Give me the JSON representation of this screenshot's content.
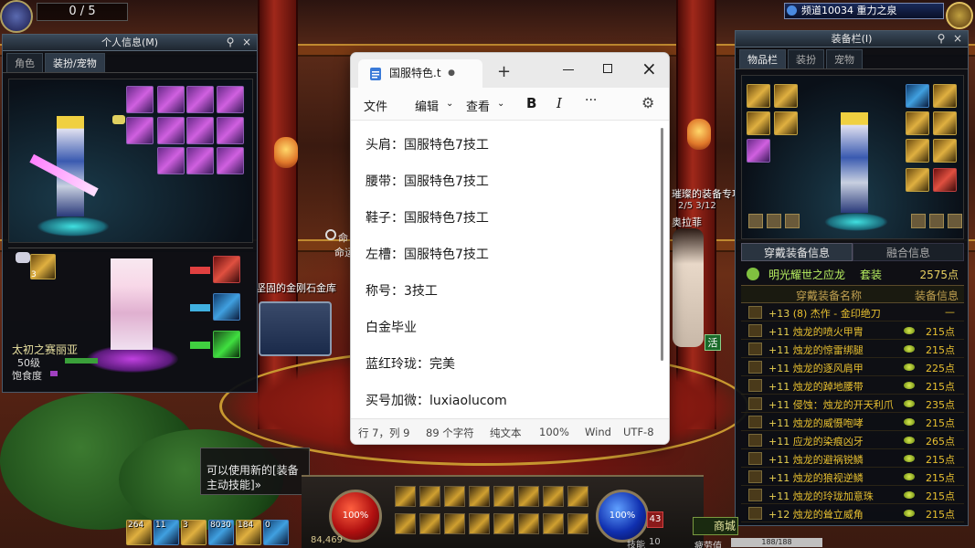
{
  "game": {
    "top_left_counter": "0 / 5",
    "channel": "频道10034 重力之泉",
    "hp_percent": "100%",
    "mp_percent": "100%",
    "level_badge": "43",
    "exp_value": "84,469",
    "fatigue_label": "疲劳值",
    "fatigue_value": "188/188",
    "skill_label": "技能",
    "skill_value": "10",
    "shop_label": "商城",
    "tip_text_1": "可以使用新的[装备",
    "tip_text_2": "主动技能]»",
    "world_label_1": "坚固的金刚石金库",
    "world_label_2": "璀璨的装备专项i",
    "world_label_2b": "2/5  3/12",
    "npc_name": "奥拉菲",
    "world_label_3a": "命",
    "world_label_3b": "命运",
    "activity_label": "活",
    "hotbar_counts": [
      "264",
      "11",
      "3",
      "8030",
      "184",
      "0"
    ]
  },
  "personal_panel": {
    "title": "个人信息(M)",
    "tabs": [
      "角色",
      "装扮/宠物"
    ],
    "pet_name": "太初之赛丽亚",
    "pet_level": "50级",
    "pet_satiety_label": "饱食度",
    "pet_slot_count": "3"
  },
  "equip_panel": {
    "title": "装备栏(I)",
    "tabs": [
      "物品栏",
      "装扮",
      "宠物"
    ],
    "info_tabs": [
      "穿戴装备信息",
      "融合信息"
    ],
    "set_name": "明光耀世之应龙",
    "set_label": "套装",
    "set_points": "2575点",
    "col_name": "穿戴装备名称",
    "col_info": "装备信息",
    "rows": [
      {
        "prefix": "+13",
        "name": "(8) 杰作 - 金印绝刀",
        "points": "—"
      },
      {
        "prefix": "+11",
        "name": "烛龙的喷火甲胄",
        "points": "215点"
      },
      {
        "prefix": "+11",
        "name": "烛龙的惊雷绑腿",
        "points": "215点"
      },
      {
        "prefix": "+11",
        "name": "烛龙的逐风肩甲",
        "points": "225点"
      },
      {
        "prefix": "+11",
        "name": "烛龙的踔地腰带",
        "points": "215点"
      },
      {
        "prefix": "+11",
        "name": "侵蚀：烛龙的开天利爪",
        "points": "235点"
      },
      {
        "prefix": "+11",
        "name": "烛龙的威慑咆哮",
        "points": "215点"
      },
      {
        "prefix": "+11",
        "name": "应龙的染痕凶牙",
        "points": "265点"
      },
      {
        "prefix": "+11",
        "name": "烛龙的避祸锐鳞",
        "points": "215点"
      },
      {
        "prefix": "+11",
        "name": "烛龙的狼视逆鳞",
        "points": "215点"
      },
      {
        "prefix": "+11",
        "name": "烛龙的玲珑加意珠",
        "points": "215点"
      },
      {
        "prefix": "+12",
        "name": "烛龙的耸立威角",
        "points": "215点"
      }
    ]
  },
  "notepad": {
    "tab_title": "国服特色.t",
    "menu": [
      "文件",
      "编辑",
      "查看"
    ],
    "lines": [
      "头肩：国服特色7技工",
      "腰带：国服特色7技工",
      "鞋子：国服特色7技工",
      "左槽：国服特色7技工",
      "称号：3技工",
      "白金毕业",
      "蓝红玲珑：完美",
      "买号加微：luxiaolucom"
    ],
    "status": {
      "position": "行 7，列 9",
      "chars": "89 个字符",
      "format": "纯文本",
      "zoom": "100%",
      "line_ending": "Wind",
      "encoding": "UTF-8"
    }
  },
  "icons": {
    "add_tab": "plus-icon",
    "bold": "bold-icon",
    "italic": "italic-icon",
    "more": "more-icon",
    "settings": "gear-icon"
  }
}
